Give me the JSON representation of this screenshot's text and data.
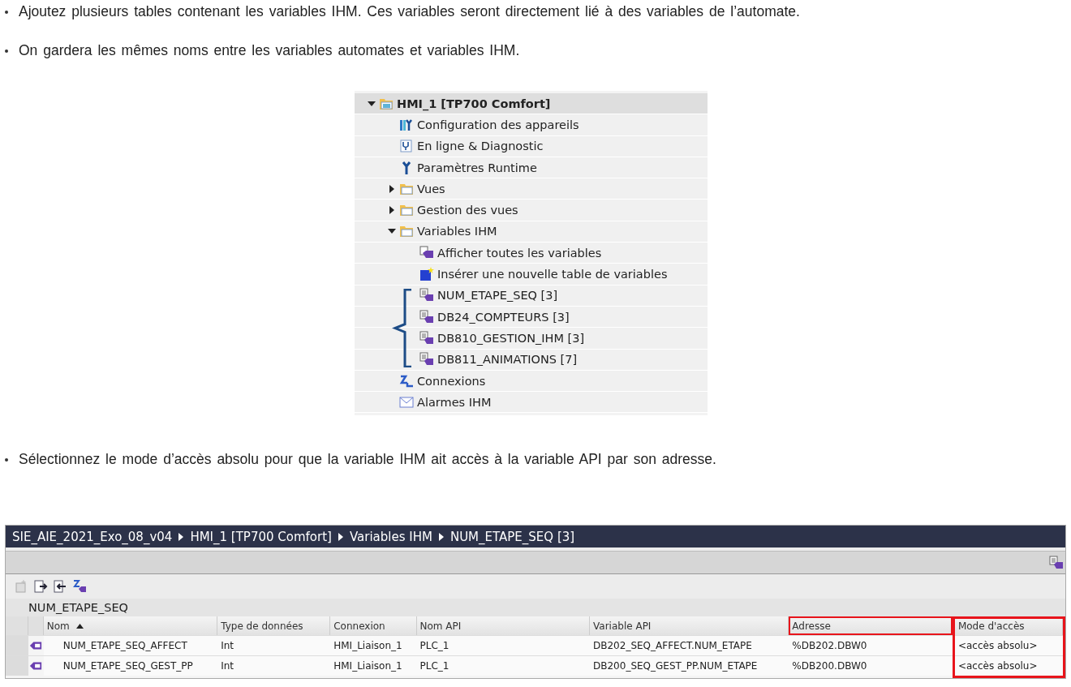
{
  "intro_bullets": [
    "Ajoutez plusieurs tables contenant les variables IHM. Ces variables seront directement lié à des variables de l’automate.",
    "On gardera les mêmes noms entre les variables automates et variables IHM."
  ],
  "tree": {
    "items": [
      {
        "label": "HMI_1 [TP700 Comfort]",
        "kind": "device",
        "expanded": true,
        "children": [
          {
            "label": "Configuration des appareils",
            "kind": "config"
          },
          {
            "label": "En ligne & Diagnostic",
            "kind": "diagnostic"
          },
          {
            "label": "Paramètres Runtime",
            "kind": "wrench"
          },
          {
            "label": "Vues",
            "kind": "folder",
            "expanded": false
          },
          {
            "label": "Gestion des vues",
            "kind": "folder",
            "expanded": false
          },
          {
            "label": "Variables IHM",
            "kind": "folder",
            "expanded": true,
            "children": [
              {
                "label": "Afficher toutes les variables",
                "kind": "tags"
              },
              {
                "label": "Insérer une nouvelle table de variables",
                "kind": "new-table"
              },
              {
                "label": "NUM_ETAPE_SEQ [3]",
                "kind": "table",
                "bracketed": true
              },
              {
                "label": "DB24_COMPTEURS [3]",
                "kind": "table",
                "bracketed": true
              },
              {
                "label": "DB810_GESTION_IHM [3]",
                "kind": "table",
                "bracketed": true
              },
              {
                "label": "DB811_ANIMATIONS [7]",
                "kind": "table",
                "bracketed": true
              }
            ]
          },
          {
            "label": "Connexions",
            "kind": "connections"
          },
          {
            "label": "Alarmes IHM",
            "kind": "alarm"
          }
        ]
      }
    ]
  },
  "access_bullet": "Sélectionnez le mode d’accès absolu pour que la variable IHM ait accès à la variable API par son adresse.",
  "editor": {
    "breadcrumb": [
      "SIE_AIE_2021_Exo_08_v04",
      "HMI_1 [TP700 Comfort]",
      "Variables IHM",
      "NUM_ETAPE_SEQ [3]"
    ],
    "table_title": "NUM_ETAPE_SEQ",
    "columns": [
      {
        "label": "Nom",
        "sorted": true,
        "header_boxed": false,
        "column_framed": false
      },
      {
        "label": "Type de données",
        "sorted": false,
        "header_boxed": false,
        "column_framed": false
      },
      {
        "label": "Connexion",
        "sorted": false,
        "header_boxed": false,
        "column_framed": false
      },
      {
        "label": "Nom API",
        "sorted": false,
        "header_boxed": false,
        "column_framed": false
      },
      {
        "label": "Variable API",
        "sorted": false,
        "header_boxed": false,
        "column_framed": false
      },
      {
        "label": "Adresse",
        "sorted": false,
        "header_boxed": true,
        "column_framed": false
      },
      {
        "label": "Mode d'accès",
        "sorted": false,
        "header_boxed": false,
        "column_framed": true
      }
    ],
    "rows": [
      {
        "cells": [
          "NUM_ETAPE_SEQ_AFFECT",
          "Int",
          "HMI_Liaison_1",
          "PLC_1",
          "DB202_SEQ_AFFECT.NUM_ETAPE",
          "%DB202.DBW0",
          "<accès absolu>"
        ]
      },
      {
        "cells": [
          "NUM_ETAPE_SEQ_GEST_PP",
          "Int",
          "HMI_Liaison_1",
          "PLC_1",
          "DB200_SEQ_GEST_PP.NUM_ETAPE",
          "%DB200.DBW0",
          "<accès absolu>"
        ]
      }
    ]
  }
}
